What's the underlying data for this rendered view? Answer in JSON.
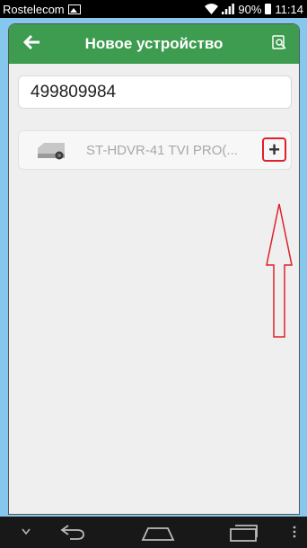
{
  "status": {
    "carrier": "Rostelecom",
    "battery": "90%",
    "time": "11:14"
  },
  "header": {
    "title": "Новое устройство"
  },
  "search_field": {
    "value": "499809984"
  },
  "device": {
    "name": "ST-HDVR-41 TVI PRO(...",
    "add_label": "+"
  },
  "colors": {
    "accent": "#3d9c4f",
    "highlight": "#e0202a",
    "background": "#86c7ee"
  },
  "icons": {
    "back": "arrow-left-icon",
    "search": "search-icon",
    "camera": "dvr-device-icon",
    "nav_down": "chevron-down-icon",
    "nav_back": "back-icon",
    "nav_home": "home-icon",
    "nav_recent": "recent-apps-icon",
    "nav_menu": "menu-icon"
  }
}
